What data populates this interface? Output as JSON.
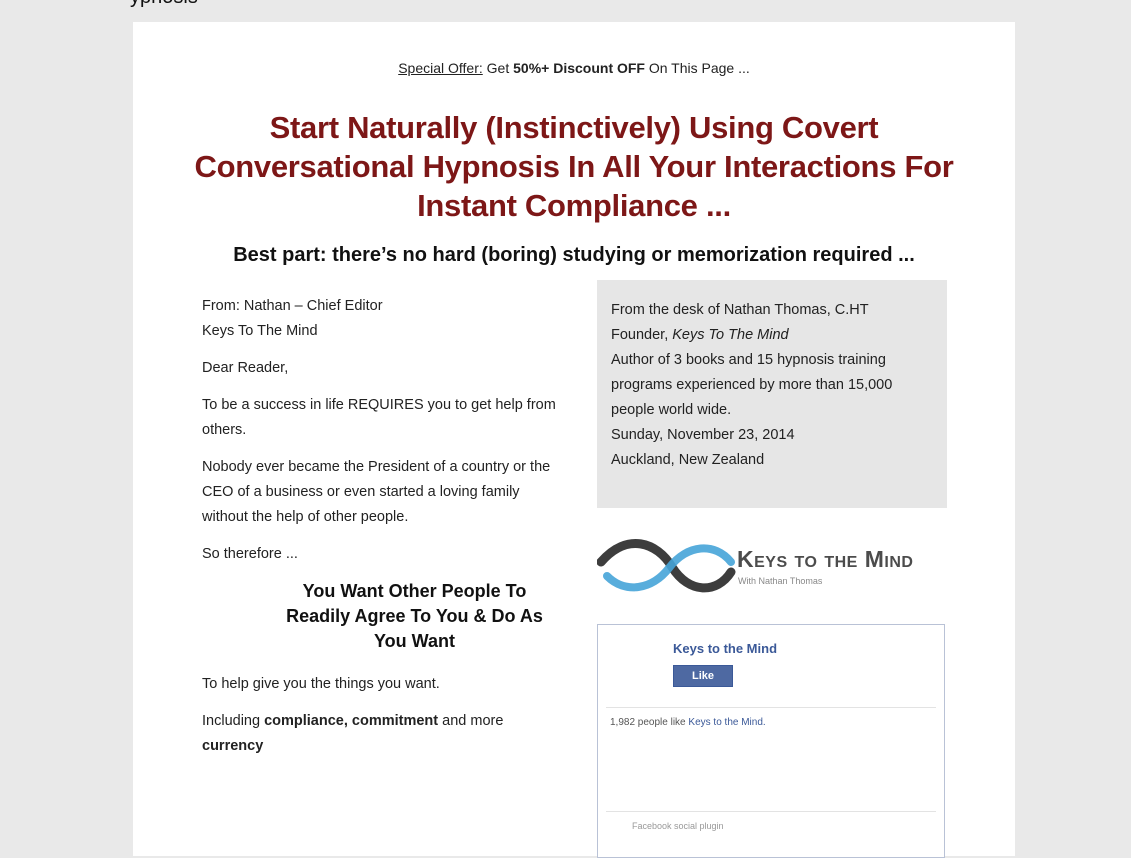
{
  "top_cut_text": "ypnosis",
  "offer": {
    "label": "Special Offer:",
    "get": " Get ",
    "discount": "50%+ Discount OFF",
    "tail": " On This Page ..."
  },
  "headline": "Start Naturally (Instinctively) Using Covert Conversational Hypnosis In All Your Interactions For Instant Compliance ...",
  "subhead": "Best part: there’s no hard (boring) studying or memorization required ...",
  "letter": {
    "from": "From: Nathan – Chief Editor",
    "org": "Keys To The Mind",
    "greeting": "Dear Reader,",
    "p1": "To be a success in life REQUIRES you to get help from others.",
    "p2": "Nobody ever became the President of a country or the CEO of a business or even started a loving family without the help of other people.",
    "p3": "So therefore ...",
    "callout": "You Want Other People To Readily Agree To You & Do As You Want",
    "p4": "To help give you the things you want.",
    "p5_pre": "Including ",
    "p5_bold": "compliance, commitment",
    "p5_mid": " and more ",
    "p5_bold2": "currency"
  },
  "desk": {
    "line1": "From the desk of Nathan Thomas, C.HT",
    "founder_pre": "Founder, ",
    "founder_em": "Keys To The Mind",
    "line3": "Author of 3 books and 15 hypnosis training programs experienced by more than 15,000 people world wide.",
    "date": "Sunday, November 23, 2014",
    "place": "Auckland, New Zealand"
  },
  "logo": {
    "name": "Keys to the Mind",
    "by": "With Nathan Thomas"
  },
  "facebook": {
    "page_name": "Keys to the Mind",
    "like_label": "Like",
    "count_pre": "1,982 people like ",
    "count_link": "Keys to the Mind.",
    "plugin": "Facebook social plugin"
  },
  "colors": {
    "headline": "#7d1717",
    "fb_blue": "#3b5998",
    "panel_gray": "#e6e6e6"
  }
}
